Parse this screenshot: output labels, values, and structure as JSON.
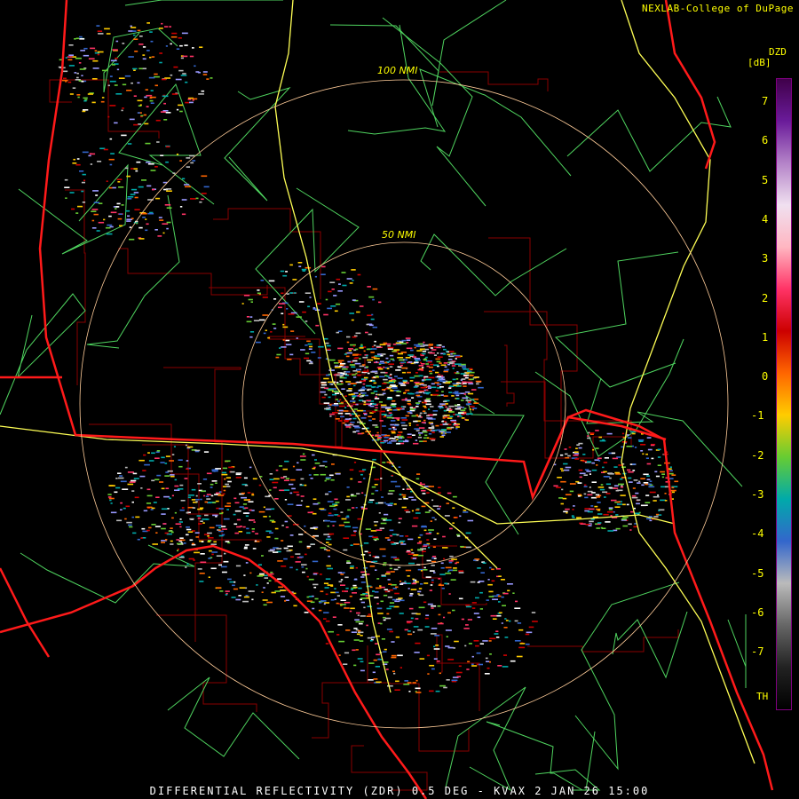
{
  "credit": "NEXLAB-College of DuPage",
  "footer": "DIFFERENTIAL REFLECTIVITY (ZDR) 0.5 DEG - KVAX 2 JAN 26 15:00",
  "legend": {
    "product": "DZD",
    "unit": "[dB]",
    "ticks": [
      "7",
      "6",
      "5",
      "4",
      "3",
      "2",
      "1",
      "0",
      "-1",
      "-2",
      "-3",
      "-4",
      "-5",
      "-6",
      "-7"
    ],
    "threshold_label": "TH",
    "color_stops": [
      "#40004a",
      "#6a1b9a",
      "#b483c8",
      "#f0e0f0",
      "#ffb6c1",
      "#ff3366",
      "#cc0000",
      "#ff6600",
      "#ffcc00",
      "#66cc33",
      "#00aaaa",
      "#3366cc",
      "#bbbbbb",
      "#666666",
      "#222222",
      "#000000"
    ]
  },
  "range_rings": [
    {
      "label": "100 NMI"
    },
    {
      "label": "50 NMI"
    }
  ],
  "colors": {
    "state_border": "#ff1a1a",
    "county_border": "#990000",
    "highway": "#ffff66",
    "road": "#55dd66",
    "ring": "#ffcc99"
  }
}
